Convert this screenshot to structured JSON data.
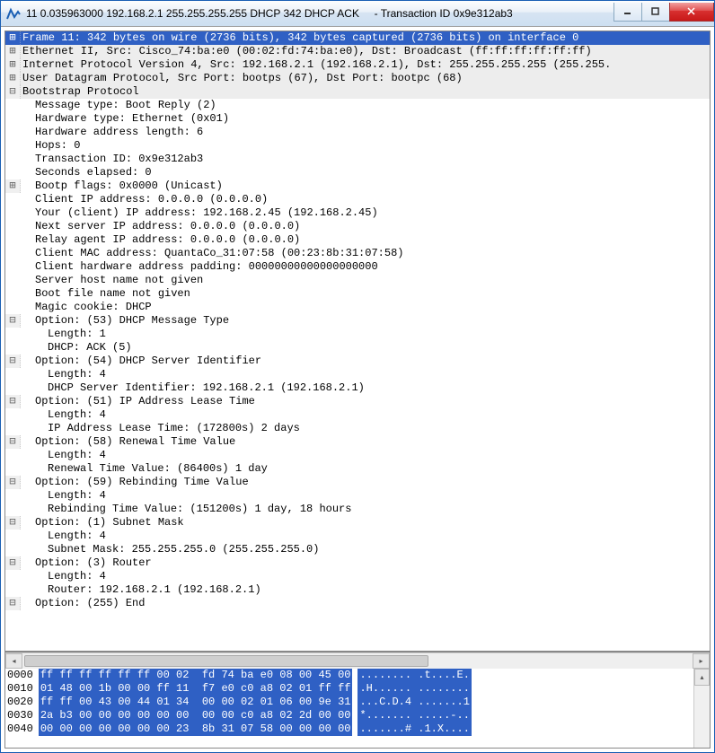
{
  "window": {
    "title": "11 0.035963000 192.168.2.1 255.255.255.255 DHCP 342 DHCP ACK     - Transaction ID 0x9e312ab3"
  },
  "tree": {
    "frame": "Frame 11: 342 bytes on wire (2736 bits), 342 bytes captured (2736 bits) on interface 0",
    "eth": "Ethernet II, Src: Cisco_74:ba:e0 (00:02:fd:74:ba:e0), Dst: Broadcast (ff:ff:ff:ff:ff:ff)",
    "ip": "Internet Protocol Version 4, Src: 192.168.2.1 (192.168.2.1), Dst: 255.255.255.255 (255.255.",
    "udp": "User Datagram Protocol, Src Port: bootps (67), Dst Port: bootpc (68)",
    "bootp": "Bootstrap Protocol",
    "bootp_children": {
      "msgtype": "Message type: Boot Reply (2)",
      "hwtype": "Hardware type: Ethernet (0x01)",
      "hwlen": "Hardware address length: 6",
      "hops": "Hops: 0",
      "xid": "Transaction ID: 0x9e312ab3",
      "secs": "Seconds elapsed: 0",
      "flags": "Bootp flags: 0x0000 (Unicast)",
      "ciaddr": "Client IP address: 0.0.0.0 (0.0.0.0)",
      "yiaddr": "Your (client) IP address: 192.168.2.45 (192.168.2.45)",
      "siaddr": "Next server IP address: 0.0.0.0 (0.0.0.0)",
      "giaddr": "Relay agent IP address: 0.0.0.0 (0.0.0.0)",
      "chaddr": "Client MAC address: QuantaCo_31:07:58 (00:23:8b:31:07:58)",
      "chpad": "Client hardware address padding: 00000000000000000000",
      "sname": "Server host name not given",
      "file": "Boot file name not given",
      "cookie": "Magic cookie: DHCP"
    },
    "opts": {
      "o53": "Option: (53) DHCP Message Type",
      "o53_len": "Length: 1",
      "o53_val": "DHCP: ACK (5)",
      "o54": "Option: (54) DHCP Server Identifier",
      "o54_len": "Length: 4",
      "o54_val": "DHCP Server Identifier: 192.168.2.1 (192.168.2.1)",
      "o51": "Option: (51) IP Address Lease Time",
      "o51_len": "Length: 4",
      "o51_val": "IP Address Lease Time: (172800s) 2 days",
      "o58": "Option: (58) Renewal Time Value",
      "o58_len": "Length: 4",
      "o58_val": "Renewal Time Value: (86400s) 1 day",
      "o59": "Option: (59) Rebinding Time Value",
      "o59_len": "Length: 4",
      "o59_val": "Rebinding Time Value: (151200s) 1 day, 18 hours",
      "o1": "Option: (1) Subnet Mask",
      "o1_len": "Length: 4",
      "o1_val": "Subnet Mask: 255.255.255.0 (255.255.255.0)",
      "o3": "Option: (3) Router",
      "o3_len": "Length: 4",
      "o3_val": "Router: 192.168.2.1 (192.168.2.1)",
      "o255": "Option: (255) End"
    }
  },
  "hex": {
    "rows": [
      {
        "off": "0000",
        "b": "ff ff ff ff ff ff 00 02  fd 74 ba e0 08 00 45 00",
        "a": "........ .t....E."
      },
      {
        "off": "0010",
        "b": "01 48 00 1b 00 00 ff 11  f7 e0 c0 a8 02 01 ff ff",
        "a": ".H...... ........"
      },
      {
        "off": "0020",
        "b": "ff ff 00 43 00 44 01 34  00 00 02 01 06 00 9e 31",
        "a": "...C.D.4 .......1"
      },
      {
        "off": "0030",
        "b": "2a b3 00 00 00 00 00 00  00 00 c0 a8 02 2d 00 00",
        "a": "*....... .....-.."
      },
      {
        "off": "0040",
        "b": "00 00 00 00 00 00 00 23  8b 31 07 58 00 00 00 00",
        "a": ".......# .1.X...."
      }
    ]
  }
}
